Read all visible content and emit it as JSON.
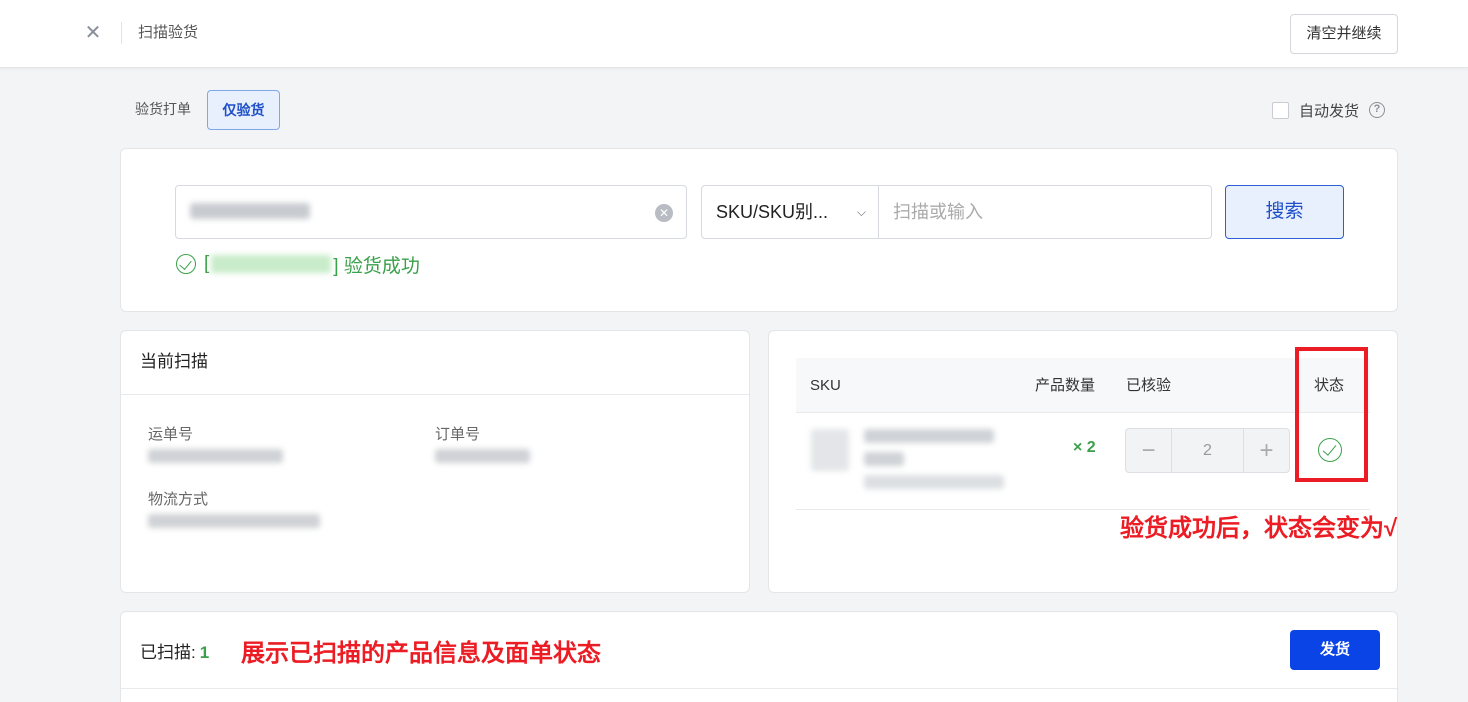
{
  "header": {
    "title": "扫描验货",
    "clear_button": "清空并继续"
  },
  "mode": {
    "label": "验货打单",
    "active": "仅验货"
  },
  "auto_ship": {
    "label": "自动发货",
    "help": "?"
  },
  "search": {
    "select_value": "SKU/SKU别...",
    "scan_placeholder": "扫描或输入",
    "button": "搜索",
    "success_open": "[",
    "success_close": "] 验货成功"
  },
  "current_scan": {
    "title": "当前扫描",
    "waybill_label": "运单号",
    "order_label": "订单号",
    "logistics_label": "物流方式"
  },
  "sku_table": {
    "headers": {
      "sku": "SKU",
      "qty": "产品数量",
      "verified": "已核验",
      "status": "状态"
    },
    "row": {
      "qty": "× 2",
      "verified_value": "2",
      "minus": "−",
      "plus": "+"
    }
  },
  "annotations": {
    "status_note": "验货成功后，状态会变为√",
    "scanned_note": "展示已扫描的产品信息及面单状态"
  },
  "scanned": {
    "label": "已扫描:",
    "count": "1",
    "ship_button": "发货"
  },
  "colors": {
    "primary": "#0b44e6",
    "success": "#3aa04a",
    "annotation_red": "#ec1c24"
  }
}
